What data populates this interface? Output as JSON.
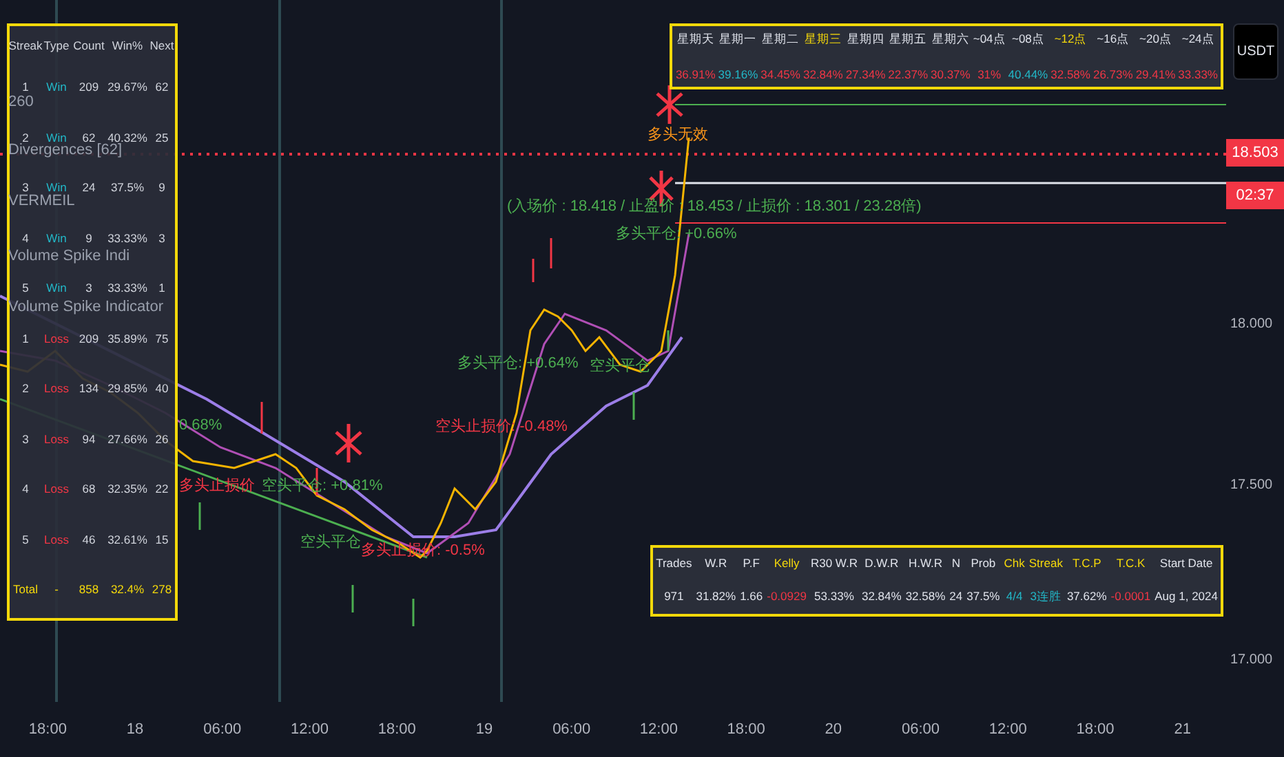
{
  "streak_table": {
    "columns": [
      "Streak",
      "Type",
      "Count",
      "Win%",
      "Next"
    ],
    "rows": [
      {
        "streak": "1",
        "type": "Win",
        "kind": "win",
        "count": "209",
        "win_rate": "29.67%",
        "next": "62"
      },
      {
        "streak": "2",
        "type": "Win",
        "kind": "win",
        "count": "62",
        "win_rate": "40.32%",
        "next": "25"
      },
      {
        "streak": "3",
        "type": "Win",
        "kind": "win",
        "count": "24",
        "win_rate": "37.5%",
        "next": "9"
      },
      {
        "streak": "4",
        "type": "Win",
        "kind": "win",
        "count": "9",
        "win_rate": "33.33%",
        "next": "3"
      },
      {
        "streak": "5",
        "type": "Win",
        "kind": "win",
        "count": "3",
        "win_rate": "33.33%",
        "next": "1"
      },
      {
        "streak": "1",
        "type": "Loss",
        "kind": "loss",
        "count": "209",
        "win_rate": "35.89%",
        "next": "75"
      },
      {
        "streak": "2",
        "type": "Loss",
        "kind": "loss",
        "count": "134",
        "win_rate": "29.85%",
        "next": "40"
      },
      {
        "streak": "3",
        "type": "Loss",
        "kind": "loss",
        "count": "94",
        "win_rate": "27.66%",
        "next": "26"
      },
      {
        "streak": "4",
        "type": "Loss",
        "kind": "loss",
        "count": "68",
        "win_rate": "32.35%",
        "next": "22"
      },
      {
        "streak": "5",
        "type": "Loss",
        "kind": "loss",
        "count": "46",
        "win_rate": "32.61%",
        "next": "15"
      }
    ],
    "total": {
      "label": "Total",
      "type": "-",
      "count": "858",
      "win_rate": "32.4%",
      "next": "278"
    }
  },
  "indicator_legends": [
    "260",
    "Divergences [62]",
    "VERMEIL",
    "Volume Spike Indi",
    "Volume Spike Indicator"
  ],
  "period_table": {
    "columns": [
      {
        "label": "星期天",
        "selected": false
      },
      {
        "label": "星期一",
        "selected": false
      },
      {
        "label": "星期二",
        "selected": false
      },
      {
        "label": "星期三",
        "selected": true
      },
      {
        "label": "星期四",
        "selected": false
      },
      {
        "label": "星期五",
        "selected": false
      },
      {
        "label": "星期六",
        "selected": false
      },
      {
        "label": "~04点",
        "selected": false
      },
      {
        "label": "~08点",
        "selected": false
      },
      {
        "label": "~12点",
        "selected": true
      },
      {
        "label": "~16点",
        "selected": false
      },
      {
        "label": "~20点",
        "selected": false
      },
      {
        "label": "~24点",
        "selected": false
      }
    ],
    "values": [
      {
        "text": "36.91%",
        "color": "#f23645"
      },
      {
        "text": "39.16%",
        "color": "#22b8c8"
      },
      {
        "text": "34.45%",
        "color": "#f23645"
      },
      {
        "text": "32.84%",
        "color": "#f23645"
      },
      {
        "text": "27.34%",
        "color": "#f23645"
      },
      {
        "text": "22.37%",
        "color": "#f23645"
      },
      {
        "text": "30.37%",
        "color": "#f23645"
      },
      {
        "text": "31%",
        "color": "#f23645"
      },
      {
        "text": "40.44%",
        "color": "#22b8c8"
      },
      {
        "text": "32.58%",
        "color": "#f23645"
      },
      {
        "text": "26.73%",
        "color": "#f23645"
      },
      {
        "text": "29.41%",
        "color": "#f23645"
      },
      {
        "text": "33.33%",
        "color": "#f23645"
      }
    ]
  },
  "stats_table": {
    "columns": [
      {
        "label": "Trades",
        "color": "#e0e3eb"
      },
      {
        "label": "W.R",
        "color": "#e0e3eb"
      },
      {
        "label": "P.F",
        "color": "#e0e3eb"
      },
      {
        "label": "Kelly",
        "color": "#f5d90a"
      },
      {
        "label": "R30 W.R",
        "color": "#e0e3eb"
      },
      {
        "label": "D.W.R",
        "color": "#e0e3eb"
      },
      {
        "label": "H.W.R",
        "color": "#e0e3eb"
      },
      {
        "label": "N",
        "color": "#e0e3eb"
      },
      {
        "label": "Prob",
        "color": "#e0e3eb"
      },
      {
        "label": "Chk",
        "color": "#f5d90a"
      },
      {
        "label": "Streak",
        "color": "#f5d90a"
      },
      {
        "label": "T.C.P",
        "color": "#f5d90a"
      },
      {
        "label": "T.C.K",
        "color": "#f5d90a"
      },
      {
        "label": "Start Date",
        "color": "#e0e3eb"
      }
    ],
    "values": [
      {
        "text": "971",
        "color": "#e0e3eb"
      },
      {
        "text": "31.82%",
        "color": "#e0e3eb"
      },
      {
        "text": "1.66",
        "color": "#e0e3eb"
      },
      {
        "text": "-0.0929",
        "color": "#f23645"
      },
      {
        "text": "53.33%",
        "color": "#e0e3eb"
      },
      {
        "text": "32.84%",
        "color": "#e0e3eb"
      },
      {
        "text": "32.58%",
        "color": "#e0e3eb"
      },
      {
        "text": "24",
        "color": "#e0e3eb"
      },
      {
        "text": "37.5%",
        "color": "#e0e3eb"
      },
      {
        "text": "4/4",
        "color": "#22b8c8"
      },
      {
        "text": "3连胜",
        "color": "#22b8c8"
      },
      {
        "text": "37.62%",
        "color": "#e0e3eb"
      },
      {
        "text": "-0.0001",
        "color": "#f23645"
      },
      {
        "text": "Aug 1, 2024",
        "color": "#e0e3eb"
      }
    ]
  },
  "chart_labels": [
    {
      "text": "多头无效",
      "kind": "invalid"
    },
    {
      "text": "(入场价 : 18.418 / 止盈价 : 18.453 / 止损价 : 18.301 / 23.28倍)",
      "kind": "profit"
    },
    {
      "text": "多头平仓: +0.66%",
      "kind": "profit"
    },
    {
      "text": "多头平仓: +0.64%",
      "kind": "profit"
    },
    {
      "text": "空头平仓",
      "kind": "profit"
    },
    {
      "text": "0.68%",
      "kind": "profit"
    },
    {
      "text": "空头止损价: -0.48%",
      "kind": "loss"
    },
    {
      "text": "多头止损价",
      "kind": "loss"
    },
    {
      "text": "空头平仓: +0.81%",
      "kind": "profit"
    },
    {
      "text": "空头平仓",
      "kind": "profit"
    },
    {
      "text": "多头止损价: -0.5%",
      "kind": "loss"
    }
  ],
  "price_axis": {
    "currency_button": "USDT",
    "last_price": "18.503",
    "countdown": "02:37",
    "ticks": [
      "18.000",
      "17.500",
      "17.000"
    ]
  },
  "time_axis": [
    "18:00",
    "18",
    "06:00",
    "12:00",
    "18:00",
    "19",
    "06:00",
    "12:00",
    "18:00",
    "20",
    "06:00",
    "12:00",
    "18:00",
    "21"
  ]
}
